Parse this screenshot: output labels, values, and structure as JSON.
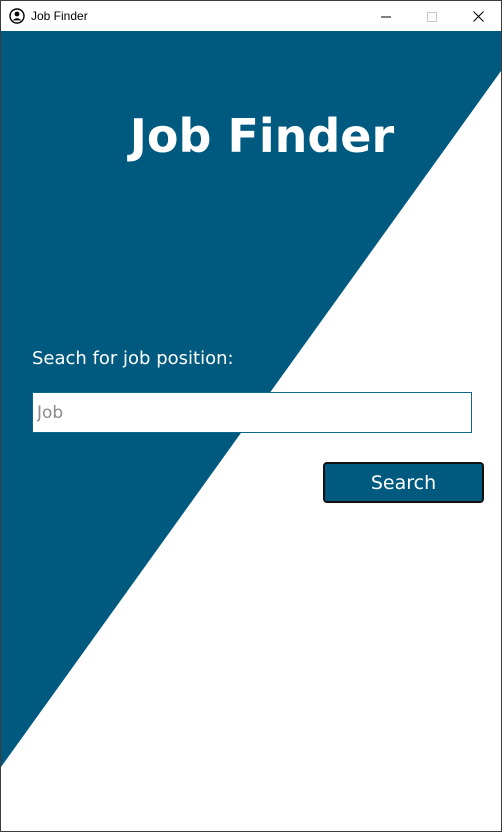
{
  "window": {
    "title": "Job Finder",
    "icon": "person-search-icon",
    "controls": {
      "minimize": "minimize-icon",
      "maximize": "maximize-icon",
      "close": "close-icon"
    }
  },
  "main": {
    "title": "Job Finder",
    "search_label": "Seach for job position:",
    "search_input": {
      "value": "",
      "placeholder": "Job"
    },
    "search_button_label": "Search"
  },
  "colors": {
    "accent": "#005a80",
    "background": "#ffffff",
    "text_on_accent": "#ffffff"
  }
}
